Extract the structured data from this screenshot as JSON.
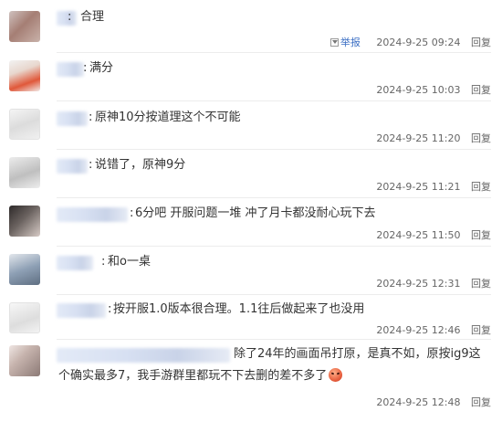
{
  "comments": [
    {
      "text": "合理",
      "date": "2024-9-25 09:24",
      "report": "举报",
      "reply": "回复"
    },
    {
      "text": "满分",
      "date": "2024-9-25 10:03",
      "reply": "回复"
    },
    {
      "text": "原神10分按道理这个不可能",
      "date": "2024-9-25 11:20",
      "reply": "回复"
    },
    {
      "text": "说错了，原神9分",
      "date": "2024-9-25 11:21",
      "reply": "回复"
    },
    {
      "text": "6分吧 开服问题一堆 冲了月卡都没耐心玩下去",
      "date": "2024-9-25 11:50",
      "reply": "回复"
    },
    {
      "text": "和o一桌",
      "date": "2024-9-25 12:31",
      "reply": "回复"
    },
    {
      "text": "按开服1.0版本很合理。1.1往后做起来了也没用",
      "date": "2024-9-25 12:46",
      "reply": "回复"
    },
    {
      "text": "除了24年的画面吊打原，是真不如，原按ig9这",
      "text2": "个确实最多7，我手游群里都玩不下去删的差不多了",
      "emoji": "angry-face-emoji",
      "date": "2024-9-25 12:48",
      "reply": "回复"
    }
  ]
}
